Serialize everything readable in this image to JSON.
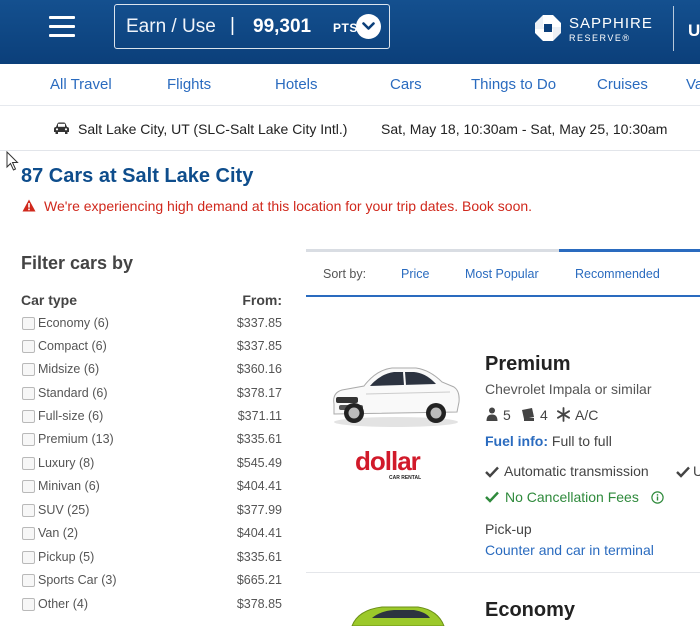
{
  "header": {
    "earn_use": "Earn / Use",
    "separator": "|",
    "points": "99,301",
    "points_unit": "PTS",
    "brand_line1": "SAPPHIRE",
    "brand_line2": "RESERVE®",
    "brand_cut": "U",
    "colors": {
      "bar": "#0b3f7a",
      "link": "#2a6bbf",
      "alert": "#d0281c",
      "green": "#2f8a3c"
    }
  },
  "nav": {
    "items": [
      "All Travel",
      "Flights",
      "Hotels",
      "Cars",
      "Things to Do",
      "Cruises",
      "Va"
    ]
  },
  "trip": {
    "location": "Salt Lake City, UT (SLC-Salt Lake City Intl.)",
    "dates": "Sat, May 18, 10:30am - Sat, May 25, 10:30am"
  },
  "results": {
    "title": "87 Cars at Salt Lake City",
    "alert": "We're experiencing high demand at this location for your trip dates. Book soon."
  },
  "filters": {
    "title": "Filter cars by",
    "col_type": "Car type",
    "col_from": "From:",
    "rows": [
      {
        "label": "Economy (6)",
        "price": "$337.85"
      },
      {
        "label": "Compact (6)",
        "price": "$337.85"
      },
      {
        "label": "Midsize (6)",
        "price": "$360.16"
      },
      {
        "label": "Standard (6)",
        "price": "$378.17"
      },
      {
        "label": "Full-size (6)",
        "price": "$371.11"
      },
      {
        "label": "Premium (13)",
        "price": "$335.61"
      },
      {
        "label": "Luxury (8)",
        "price": "$545.49"
      },
      {
        "label": "Minivan (6)",
        "price": "$404.41"
      },
      {
        "label": "SUV (25)",
        "price": "$377.99"
      },
      {
        "label": "Van (2)",
        "price": "$404.41"
      },
      {
        "label": "Pickup (5)",
        "price": "$335.61"
      },
      {
        "label": "Sports Car (3)",
        "price": "$665.21"
      },
      {
        "label": "Other (4)",
        "price": "$378.85"
      }
    ]
  },
  "sort": {
    "label": "Sort by:",
    "options": [
      "Price",
      "Most Popular",
      "Recommended"
    ],
    "active": "Recommended"
  },
  "cards": [
    {
      "class": "Premium",
      "model": "Chevrolet Impala or similar",
      "passengers": "5",
      "bags": "4",
      "ac": "A/C",
      "fuel_label": "Fuel info:",
      "fuel_value": "Full to full",
      "transmission": "Automatic transmission",
      "cut_feature": "U",
      "cancellation": "No Cancellation Fees",
      "pickup_label": "Pick-up",
      "pickup_value": "Counter and car in terminal",
      "vendor_logo": "dollar",
      "vendor_sub": "CAR RENTAL"
    },
    {
      "class": "Economy"
    }
  ]
}
